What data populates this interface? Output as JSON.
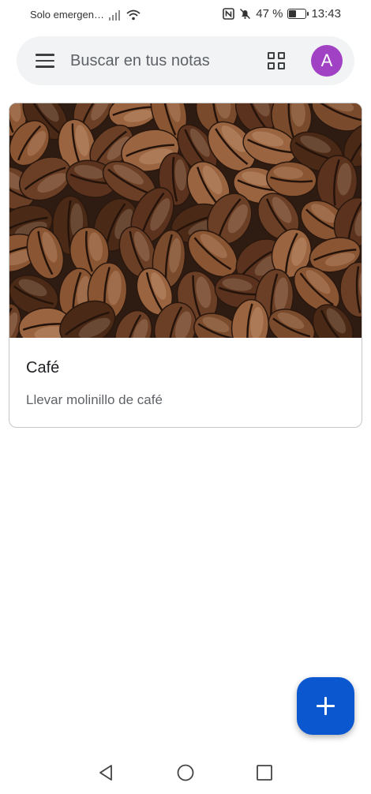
{
  "status_bar": {
    "carrier": "Solo emergen…",
    "battery": "47 %",
    "battery_level": 0.47,
    "time": "13:43",
    "icons": [
      "signal-icon",
      "wifi-icon",
      "nfc-icon",
      "mute-icon",
      "battery-icon"
    ]
  },
  "search": {
    "placeholder": "Buscar en tus notas"
  },
  "account": {
    "initial": "A",
    "avatar_color": "#a142c5"
  },
  "notes": [
    {
      "title": "Café",
      "body": "Llevar molinillo de café",
      "image": "coffee-beans-photo"
    }
  ],
  "fab": {
    "icon": "plus-icon",
    "color": "#0b57d0"
  },
  "nav": {
    "icons": [
      "back-icon",
      "home-icon",
      "recents-icon"
    ]
  }
}
